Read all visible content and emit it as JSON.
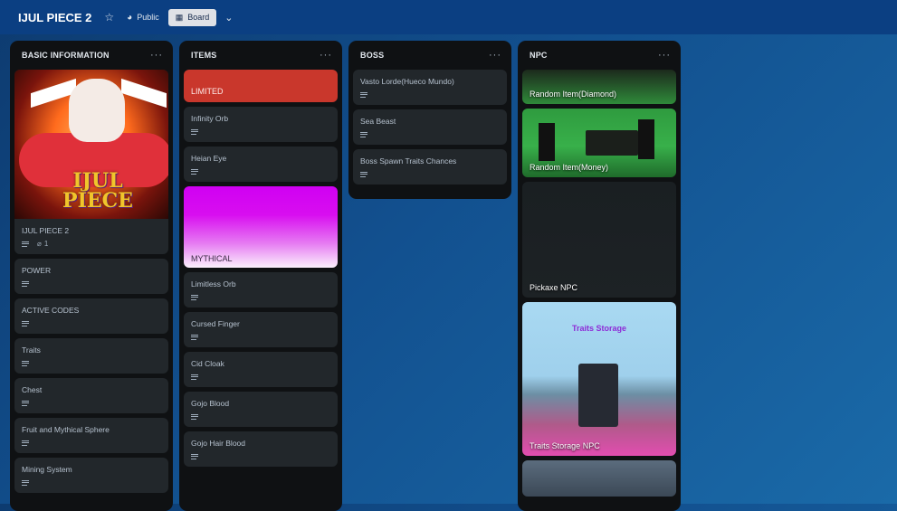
{
  "topbar": {
    "board_title": "IJUL PIECE 2",
    "visibility_label": "Public",
    "view_label": "Board",
    "icons": [
      "star-icon",
      "globe-icon",
      "board-icon",
      "chevron-down-icon"
    ]
  },
  "lists": [
    {
      "title": "BASIC INFORMATION",
      "cover_logo_text": "IJUL PIECE",
      "cards": [
        {
          "title": "IJUL PIECE 2",
          "attachments": "1"
        },
        {
          "title": "POWER"
        },
        {
          "title": "ACTIVE CODES"
        },
        {
          "title": "Traits"
        },
        {
          "title": "Chest"
        },
        {
          "title": "Fruit and Mythical Sphere"
        },
        {
          "title": "Mining System"
        }
      ]
    },
    {
      "title": "ITEMS",
      "label_limited": "LIMITED",
      "label_mythical": "MYTHICAL",
      "cards_a": [
        {
          "title": "Infinity Orb"
        },
        {
          "title": "Heian Eye"
        }
      ],
      "cards_b": [
        {
          "title": "Limitless Orb"
        },
        {
          "title": "Cursed Finger"
        },
        {
          "title": "Cid Cloak"
        },
        {
          "title": "Gojo Blood"
        },
        {
          "title": "Gojo Hair Blood"
        }
      ]
    },
    {
      "title": "BOSS",
      "cards": [
        {
          "title": "Vasto Lorde(Hueco Mundo)"
        },
        {
          "title": "Sea Beast"
        },
        {
          "title": "Boss Spawn Traits Chances"
        }
      ]
    },
    {
      "title": "NPC",
      "cards": [
        {
          "title": "Random Item(Diamond)"
        },
        {
          "title": "Random Item(Money)"
        },
        {
          "title": "Pickaxe NPC"
        },
        {
          "title": "Traits Storage NPC",
          "image_caption": "Traits Storage"
        }
      ]
    }
  ]
}
